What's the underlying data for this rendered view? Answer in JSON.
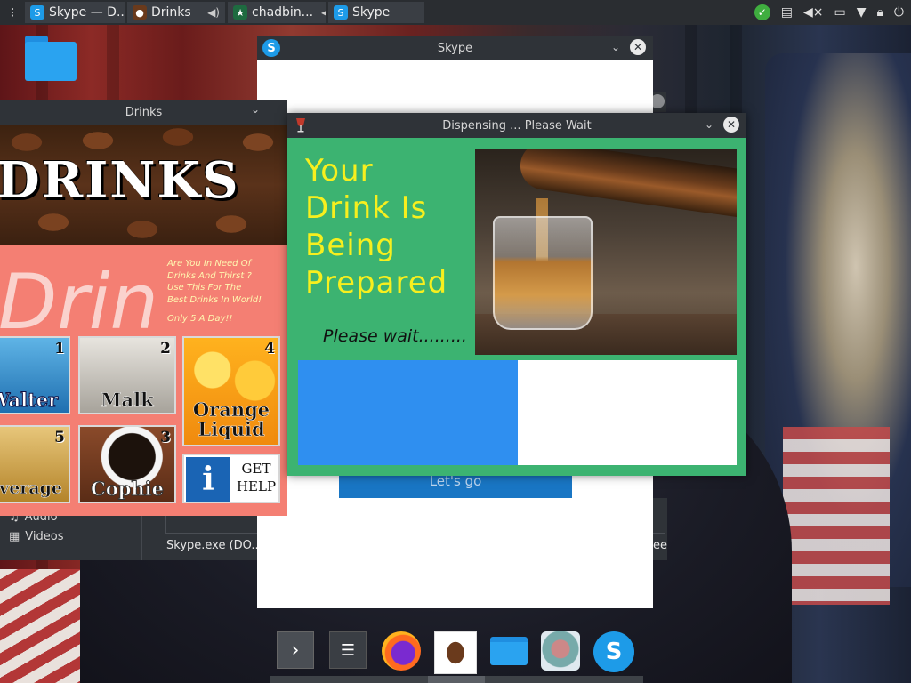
{
  "panel": {
    "tasks": [
      {
        "label": "Skype — D...",
        "icon": "skype-icon"
      },
      {
        "label": "Drinks",
        "icon": "coffee-beans-icon"
      },
      {
        "label": "chadbin...",
        "icon": "starbucks-icon"
      },
      {
        "label": "Skype",
        "icon": "skype-icon"
      }
    ],
    "tray_icons": [
      "update-ok-icon",
      "clipboard-icon",
      "volume-muted-icon",
      "network-icon",
      "arrow-down-icon",
      "lock-icon",
      "power-icon"
    ]
  },
  "skype_window": {
    "title": "Skype",
    "button": "Let's go"
  },
  "file_manager": {
    "places": [
      {
        "label": "Audio",
        "icon": "music-note-icon"
      },
      {
        "label": "Videos",
        "icon": "film-icon"
      }
    ],
    "file_name": "Skype.exe (DO...e",
    "file_name_2": "ee"
  },
  "drinks_window": {
    "title": "Drinks",
    "logo_text": "DRINKS",
    "big_text": "Drin",
    "promo_lines": [
      "Are You In Need Of",
      "Drinks And Thirst ?",
      "Use This For The",
      "Best Drinks In World!"
    ],
    "price": "Only 5 A Day!!",
    "tiles": [
      {
        "num": "1",
        "label": "Walter"
      },
      {
        "num": "2",
        "label": "Malk"
      },
      {
        "num": "4",
        "label": "Orange Liquid"
      },
      {
        "num": "5",
        "label": "Beverage"
      },
      {
        "num": "3",
        "label": "Cophie"
      }
    ],
    "help": {
      "get": "GET",
      "help": "HELP",
      "icon": "i"
    }
  },
  "dispense_window": {
    "title": "Dispensing ... Please Wait",
    "heading_lines": [
      "Your",
      "Drink Is",
      "Being",
      "Prepared"
    ],
    "wait_text": "Please wait.........",
    "progress_fraction": 0.5
  },
  "dock": {
    "items": [
      "expand-arrow-icon",
      "settings-icon",
      "firefox-icon",
      "coffee-beans-icon",
      "folder-icon",
      "avatar-icon",
      "skype-icon"
    ]
  }
}
